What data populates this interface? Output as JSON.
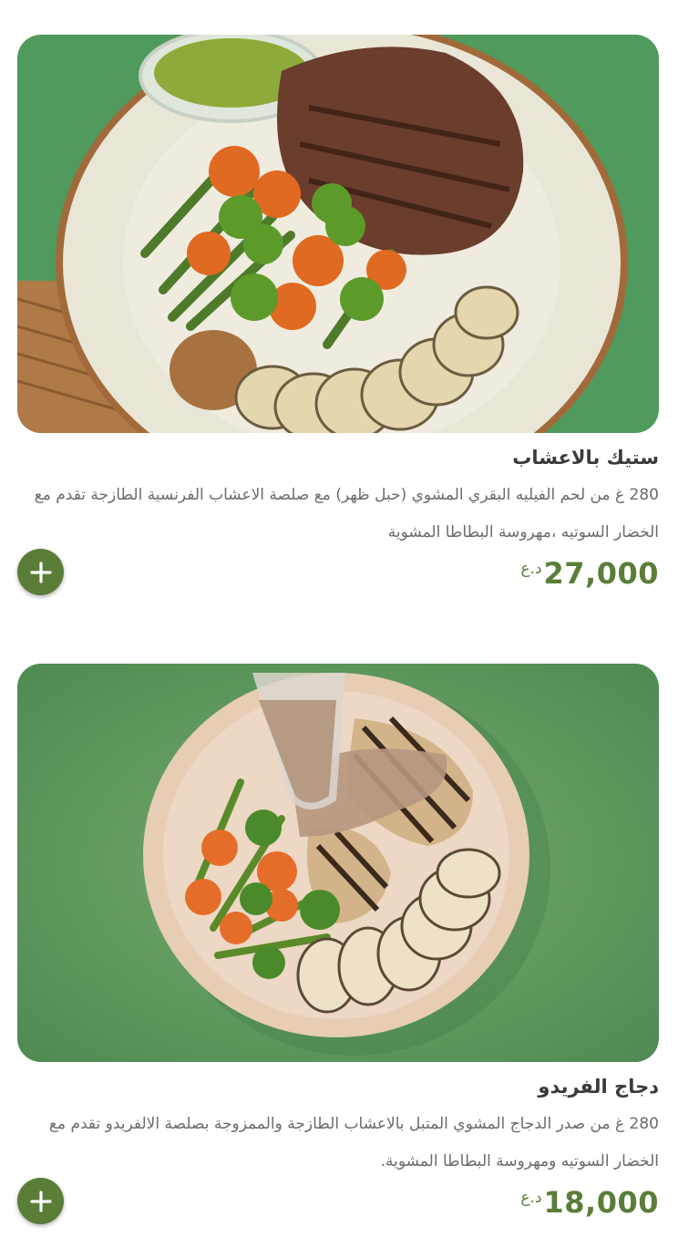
{
  "items": [
    {
      "name": "ستيك بالاعشاب",
      "description": "280 غ من لحم الفيليه البقري المشوي (حبل ظهر) مع صلصة الاعشاب الفرنسية الطازجة تقدم مع الخضار السوتيه ،مهروسة البطاطا المشوية",
      "price": "27,000",
      "currency": "د.ع",
      "add_icon": "plus-icon"
    },
    {
      "name": "دجاج الفريدو",
      "description": "280 غ من صدر الدجاج المشوي المتبل بالاعشاب الطازجة والممزوجة بصلصة الالفريدو تقدم مع الخضار السوتيه ومهروسة البطاطا المشوية.",
      "price": "18,000",
      "currency": "د.ع",
      "add_icon": "plus-icon"
    }
  ],
  "colors": {
    "accent": "#5a7d38",
    "title": "#3a3a3a",
    "description": "#6b6b6b"
  }
}
